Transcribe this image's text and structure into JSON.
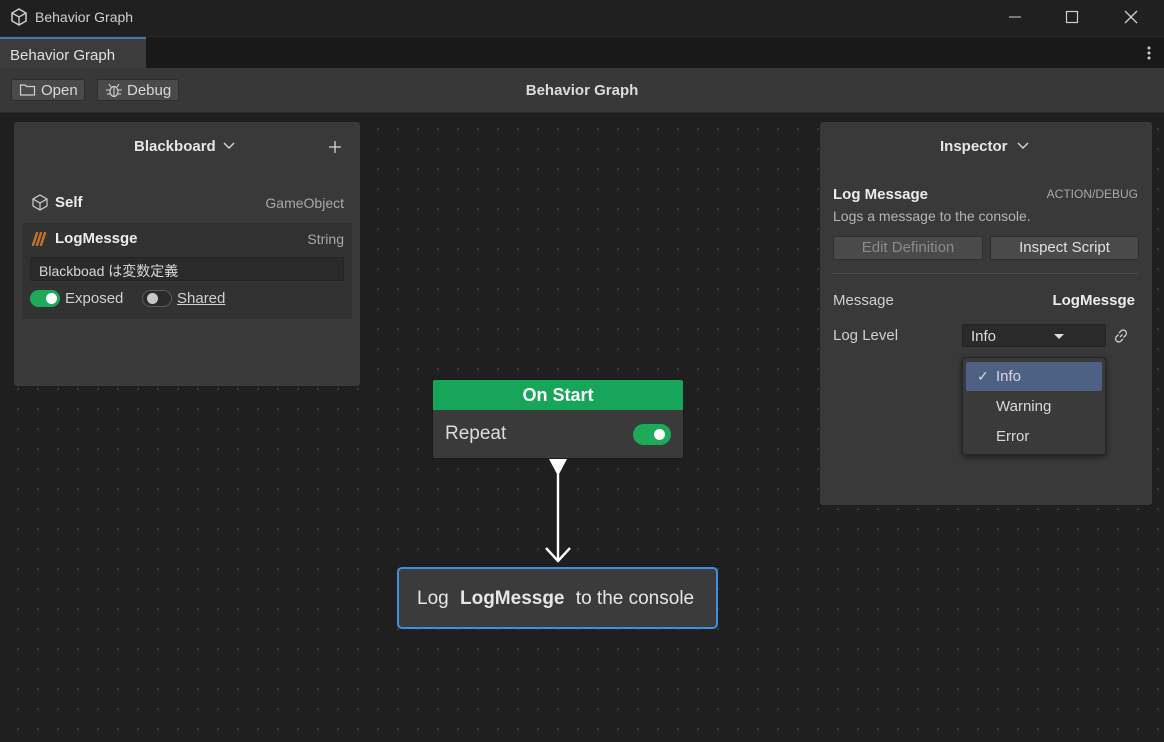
{
  "window": {
    "title": "Behavior Graph"
  },
  "tabs": [
    {
      "label": "Behavior Graph"
    }
  ],
  "toolbar": {
    "open_label": "Open",
    "debug_label": "Debug",
    "title": "Behavior Graph"
  },
  "blackboard": {
    "title": "Blackboard",
    "items": [
      {
        "name": "Self",
        "type": "GameObject",
        "icon": "cube-icon"
      },
      {
        "name": "LogMessge",
        "type": "String",
        "icon": "string-quote-icon",
        "value": "Blackboad は変数定義",
        "exposed_label": "Exposed",
        "exposed": true,
        "shared_label": "Shared",
        "shared": false
      }
    ]
  },
  "graph": {
    "start_node": {
      "title": "On Start",
      "repeat_label": "Repeat",
      "repeat": true
    },
    "log_node": {
      "prefix": "Log",
      "variable": "LogMessge",
      "suffix": "to the console"
    }
  },
  "inspector": {
    "title": "Inspector",
    "node_name": "Log Message",
    "category": "ACTION/DEBUG",
    "description": "Logs a message to the console.",
    "edit_definition_label": "Edit Definition",
    "inspect_script_label": "Inspect Script",
    "message_label": "Message",
    "message_value": "LogMessge",
    "log_level_label": "Log Level",
    "log_level_value": "Info",
    "log_level_options": [
      "Info",
      "Warning",
      "Error"
    ],
    "check_mark": "✓"
  },
  "colors": {
    "accent_green": "#17a55a",
    "selection_blue": "#3b8fe5",
    "tab_accent": "#3a79bb",
    "string_icon": "#c8772b"
  }
}
